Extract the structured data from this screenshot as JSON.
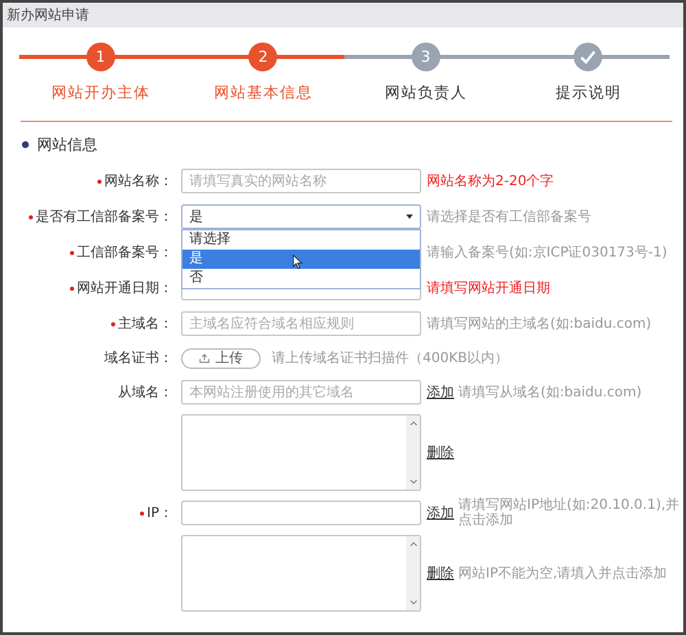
{
  "window": {
    "title": "新办网站申请"
  },
  "steps": [
    {
      "number": "1",
      "label": "网站开办主体",
      "kind": "number",
      "reached": true
    },
    {
      "number": "2",
      "label": "网站基本信息",
      "kind": "number",
      "reached": true
    },
    {
      "number": "3",
      "label": "网站负责人",
      "kind": "number",
      "reached": false
    },
    {
      "label": "提示说明",
      "kind": "check",
      "reached": false
    }
  ],
  "section": {
    "title": "网站信息"
  },
  "rows": [
    {
      "kind": "input",
      "label": "网站名称：",
      "required": true,
      "placeholder": "请填写真实的网站名称",
      "hint": "网站名称为2-20个字",
      "hint_error": true
    },
    {
      "kind": "select",
      "label": "是否有工信部备案号：",
      "required": true,
      "value": "是",
      "hint": "请选择是否有工信部备案号",
      "hint_error": false,
      "options": [
        {
          "label": "请选择",
          "selected": false
        },
        {
          "label": "是",
          "selected": true
        },
        {
          "label": "否",
          "selected": false
        }
      ]
    },
    {
      "kind": "covered",
      "label": "工信部备案号：",
      "required": true,
      "hint": "请输入备案号(如:京ICP证030173号-1)",
      "hint_error": false
    },
    {
      "kind": "input",
      "label": "网站开通日期：",
      "required": true,
      "hint": "请填写网站开通日期",
      "hint_error": true
    },
    {
      "kind": "input",
      "label": "主域名：",
      "required": true,
      "placeholder": "主域名应符合域名相应规则",
      "hint": "请填写网站的主域名(如:baidu.com)",
      "hint_error": false
    },
    {
      "kind": "upload",
      "label": "域名证书：",
      "required": false,
      "button": "上传",
      "hint": "请上传域名证书扫描件（400KB以内）",
      "hint_error": false
    },
    {
      "kind": "input",
      "label": "从域名：",
      "required": false,
      "placeholder": "本网站注册使用的其它域名",
      "link": "添加",
      "hint": "请填写从域名(如:baidu.com)",
      "hint_error": false
    },
    {
      "kind": "textarea",
      "link": "删除"
    },
    {
      "kind": "input",
      "label": "IP：",
      "required": true,
      "link": "添加",
      "hint": "请填写网站IP地址(如:20.10.0.1),并点击添加",
      "hint_error": false
    },
    {
      "kind": "textarea",
      "link": "删除",
      "hint": "网站IP不能为空,请填入并点击添加",
      "hint_error": false
    }
  ]
}
